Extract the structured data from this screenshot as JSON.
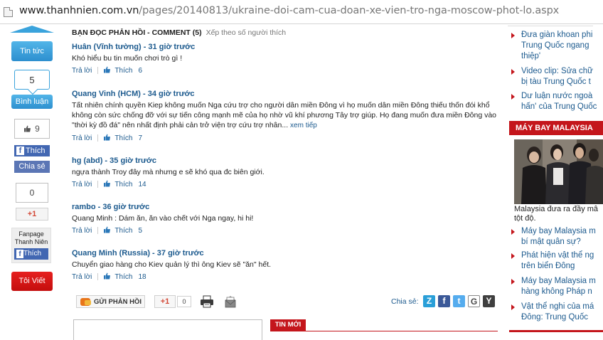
{
  "address_bar": {
    "domain": "www.thanhnien.com.vn",
    "path": "/pages/20140813/ukraine-doi-cam-cua-doan-xe-vien-tro-nga-moscow-phot-lo.aspx"
  },
  "left_sharebar": {
    "tin_tuc_label": "Tin tức",
    "comment_count": "5",
    "binh_luan_label": "Bình luận",
    "like_count": "9",
    "fb_like_label": "Thích",
    "share_label": "Chia sẻ",
    "gplus_count": "0",
    "gplus_label": "+1",
    "fanpage_line1": "Fanpage",
    "fanpage_line2": "Thanh Niên",
    "fanpage_like_label": "Thích",
    "toi_viet_label": "Tôi Viết"
  },
  "comments_section": {
    "header": "BẠN ĐỌC PHẢN HỒI - COMMENT (5)",
    "sort_label": "Xếp theo số người thích",
    "reply_label": "Trả lời",
    "like_label": "Thích",
    "items": [
      {
        "author": "Huân (Vĩnh tường) - 31 giờ trước",
        "body": "Khó hiểu bu tin muốn chơi trò gì !",
        "more": "",
        "likes": "6"
      },
      {
        "author": "Quang Vinh (HCM) - 34 giờ trước",
        "body": "Tất nhiên chính quyền Kiep không muốn Nga cứu trợ cho người dân miền Đông vì họ muốn dân miền Đông thiếu thốn đói khổ không còn sức chống đỡ với sự tiến công mạnh mẽ của họ nhờ vũ khí phương Tây trợ giúp. Họ đang muốn đưa miền Đông vào \"thời kỳ đồ đá\" nên nhất định phải cản trở viện trợ cứu trợ nhân...",
        "more": "xem tiếp",
        "likes": "7"
      },
      {
        "author": "hg (abd) - 35 giờ trước",
        "body": "ngựa thành Troy đây mà nhưng e sẽ khó qua đc biên giới.",
        "more": "",
        "likes": "14"
      },
      {
        "author": "rambo - 36 giờ trước",
        "body": "Quang Minh : Dám ăn, ăn vào chết với Nga ngay, hi hi!",
        "more": "",
        "likes": "5"
      },
      {
        "author": "Quang Minh (Russia) - 37 giờ trước",
        "body": "Chuyển giao hàng cho Kiev quản lý thì ông Kiev sẽ \"ăn\" hết.",
        "more": "",
        "likes": "18"
      }
    ]
  },
  "action_row": {
    "send_feedback_label": "GỬI PHẢN HỒI",
    "gplus_label": "+1",
    "gplus_count": "0",
    "share_label": "Chia sẻ:",
    "share_icons": [
      {
        "name": "zing-me",
        "glyph": "Z",
        "color": "#2a9fd8"
      },
      {
        "name": "facebook",
        "glyph": "f",
        "color": "#3b5998"
      },
      {
        "name": "twitter",
        "glyph": "t",
        "color": "#55acee"
      },
      {
        "name": "google",
        "glyph": "G",
        "color": "#4a4a4a"
      },
      {
        "name": "yahoo",
        "glyph": "Y",
        "color": "#3f3f3f"
      }
    ]
  },
  "bottom": {
    "tin_moi_label": "TIN MỚI"
  },
  "right_sidebar": {
    "top_links": [
      {
        "line1": "Đưa giàn khoan phi",
        "line2": "Trung Quốc ngang",
        "line3": "thiệp'"
      },
      {
        "line1": "Video clip: Sửa chữ",
        "line2": "bị tàu Trung Quốc t",
        "line3": ""
      },
      {
        "line1": "Dư luận nước ngoà",
        "line2": "hấn' của Trung Quốc",
        "line3": ""
      }
    ],
    "section_title": "MÁY BAY MALAYSIA",
    "photo_caption_line1": "Malaysia đưa ra đầy mâ",
    "photo_caption_line2": "tột độ.",
    "bottom_links": [
      {
        "line1": "Máy bay Malaysia m",
        "line2": "bí mật quân sự?"
      },
      {
        "line1": "Phát hiện vật thể ng",
        "line2": "trên biển Đông"
      },
      {
        "line1": "Máy bay Malaysia m",
        "line2": "hàng không Pháp n"
      },
      {
        "line1": "Vật thể nghi của má",
        "line2": "Đông: Trung Quốc"
      }
    ]
  }
}
